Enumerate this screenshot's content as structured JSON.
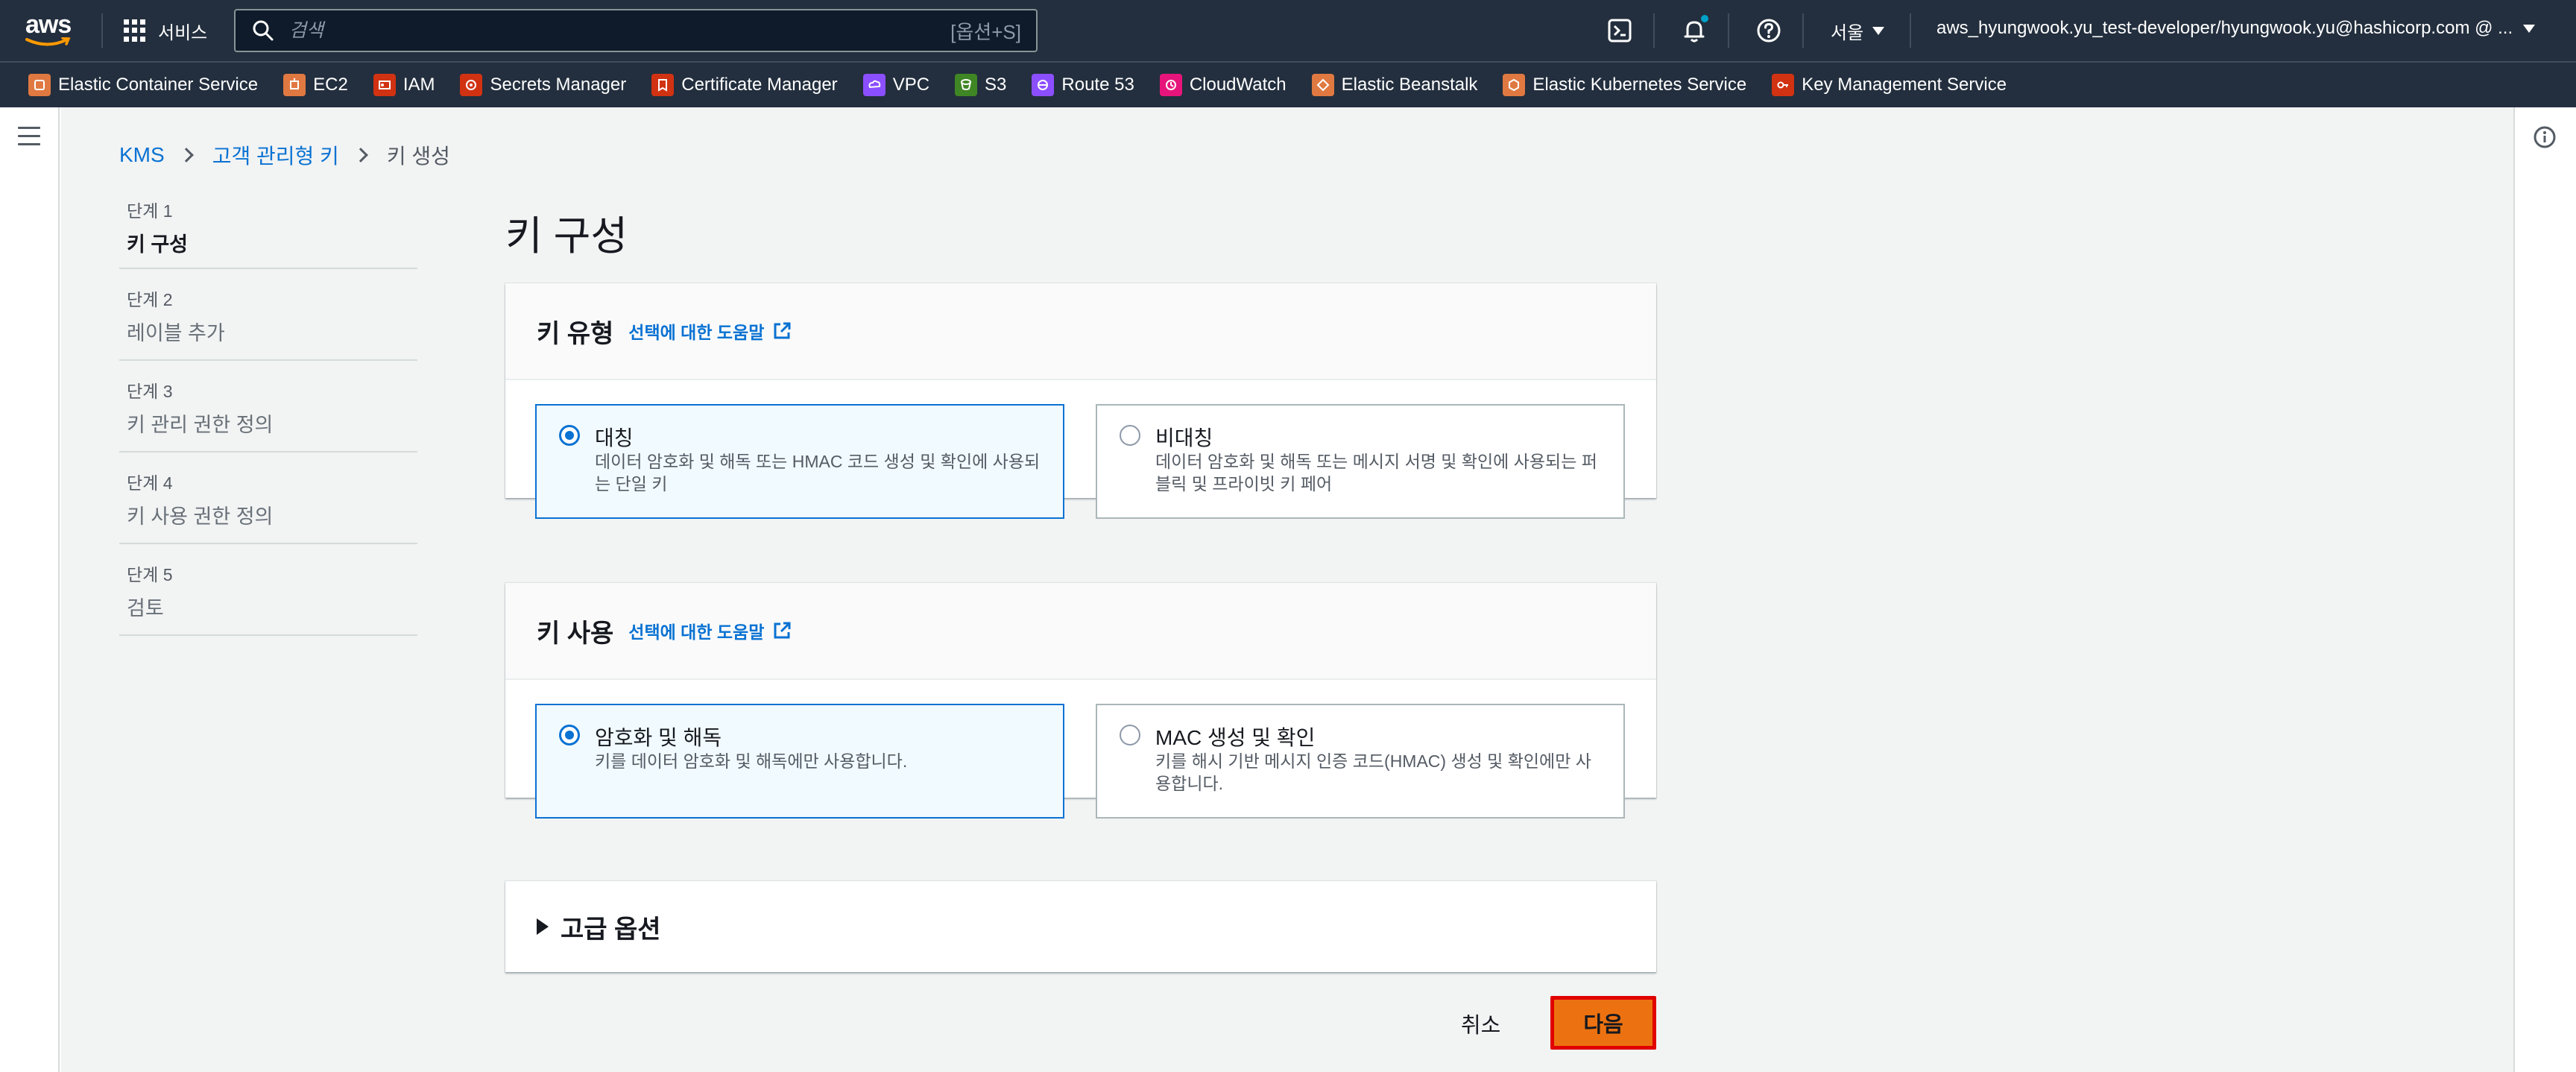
{
  "topnav": {
    "logo_text": "aws",
    "services_label": "서비스",
    "search_placeholder": "검색",
    "search_shortcut": "[옵션+S]",
    "icons": [
      "cloudshell-icon",
      "bell-icon",
      "help-icon"
    ],
    "region": "서울",
    "account": "aws_hyungwook.yu_test-developer/hyungwook.yu@hashicorp.com @ ..."
  },
  "favorites": [
    {
      "label": "Elastic Container Service",
      "color": "#e07941",
      "icon": "ecs-icon"
    },
    {
      "label": "EC2",
      "color": "#e07941",
      "icon": "ec2-icon"
    },
    {
      "label": "IAM",
      "color": "#d13212",
      "icon": "iam-icon"
    },
    {
      "label": "Secrets Manager",
      "color": "#d13212",
      "icon": "secrets-manager-icon"
    },
    {
      "label": "Certificate Manager",
      "color": "#d13212",
      "icon": "certificate-manager-icon"
    },
    {
      "label": "VPC",
      "color": "#8c4fff",
      "icon": "vpc-icon"
    },
    {
      "label": "S3",
      "color": "#3f8624",
      "icon": "s3-icon"
    },
    {
      "label": "Route 53",
      "color": "#8c4fff",
      "icon": "route53-icon"
    },
    {
      "label": "CloudWatch",
      "color": "#e7157b",
      "icon": "cloudwatch-icon"
    },
    {
      "label": "Elastic Beanstalk",
      "color": "#e07941",
      "icon": "beanstalk-icon"
    },
    {
      "label": "Elastic Kubernetes Service",
      "color": "#e07941",
      "icon": "eks-icon"
    },
    {
      "label": "Key Management Service",
      "color": "#d13212",
      "icon": "kms-icon"
    }
  ],
  "breadcrumb": {
    "items": [
      "KMS",
      "고객 관리형 키"
    ],
    "current": "키 생성"
  },
  "steps": [
    {
      "num": "단계 1",
      "name": "키 구성"
    },
    {
      "num": "단계 2",
      "name": "레이블 추가"
    },
    {
      "num": "단계 3",
      "name": "키 관리 권한 정의"
    },
    {
      "num": "단계 4",
      "name": "키 사용 권한 정의"
    },
    {
      "num": "단계 5",
      "name": "검토"
    }
  ],
  "page_title": "키 구성",
  "key_type": {
    "title": "키 유형",
    "help": "선택에 대한 도움말",
    "options": [
      {
        "label": "대칭",
        "desc": "데이터 암호화 및 해독 또는 HMAC 코드 생성 및 확인에 사용되는 단일 키",
        "selected": true
      },
      {
        "label": "비대칭",
        "desc": "데이터 암호화 및 해독 또는 메시지 서명 및 확인에 사용되는 퍼블릭 및 프라이빗 키 페어",
        "selected": false
      }
    ]
  },
  "key_usage": {
    "title": "키 사용",
    "help": "선택에 대한 도움말",
    "options": [
      {
        "label": "암호화 및 해독",
        "desc": "키를 데이터 암호화 및 해독에만 사용합니다.",
        "selected": true
      },
      {
        "label": "MAC 생성 및 확인",
        "desc": "키를 해시 기반 메시지 인증 코드(HMAC) 생성 및 확인에만 사용합니다.",
        "selected": false
      }
    ]
  },
  "advanced": {
    "title": "고급 옵션"
  },
  "actions": {
    "cancel": "취소",
    "next": "다음"
  },
  "colors": {
    "nav_bg": "#232f3e",
    "link": "#0972d3",
    "primary_button": "#ec7211",
    "highlight_border": "#e00000"
  }
}
